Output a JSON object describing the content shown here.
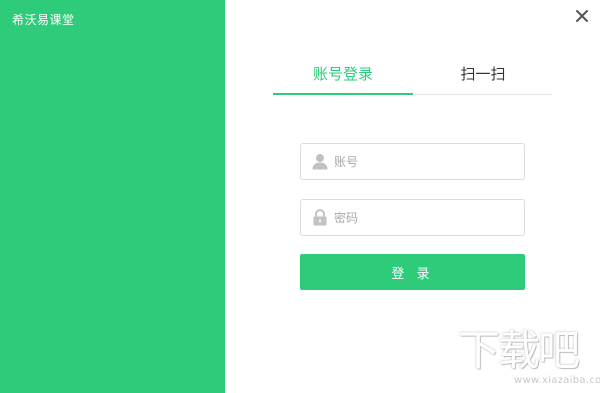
{
  "app": {
    "title": "希沃易课堂"
  },
  "window": {
    "close_icon": "close-icon"
  },
  "tabs": [
    {
      "label": "账号登录",
      "active": true
    },
    {
      "label": "扫一扫",
      "active": false
    }
  ],
  "form": {
    "account": {
      "placeholder": "账号",
      "value": "",
      "icon": "user-icon"
    },
    "password": {
      "placeholder": "密码",
      "value": "",
      "icon": "lock-icon"
    },
    "login_label": "登 录"
  },
  "watermark": {
    "brand": "下载吧",
    "url": "www.xiazaiba.com"
  },
  "colors": {
    "accent": "#2ecc7a",
    "border": "#dcdcdc",
    "text": "#333333",
    "placeholder": "#aaaaaa"
  }
}
